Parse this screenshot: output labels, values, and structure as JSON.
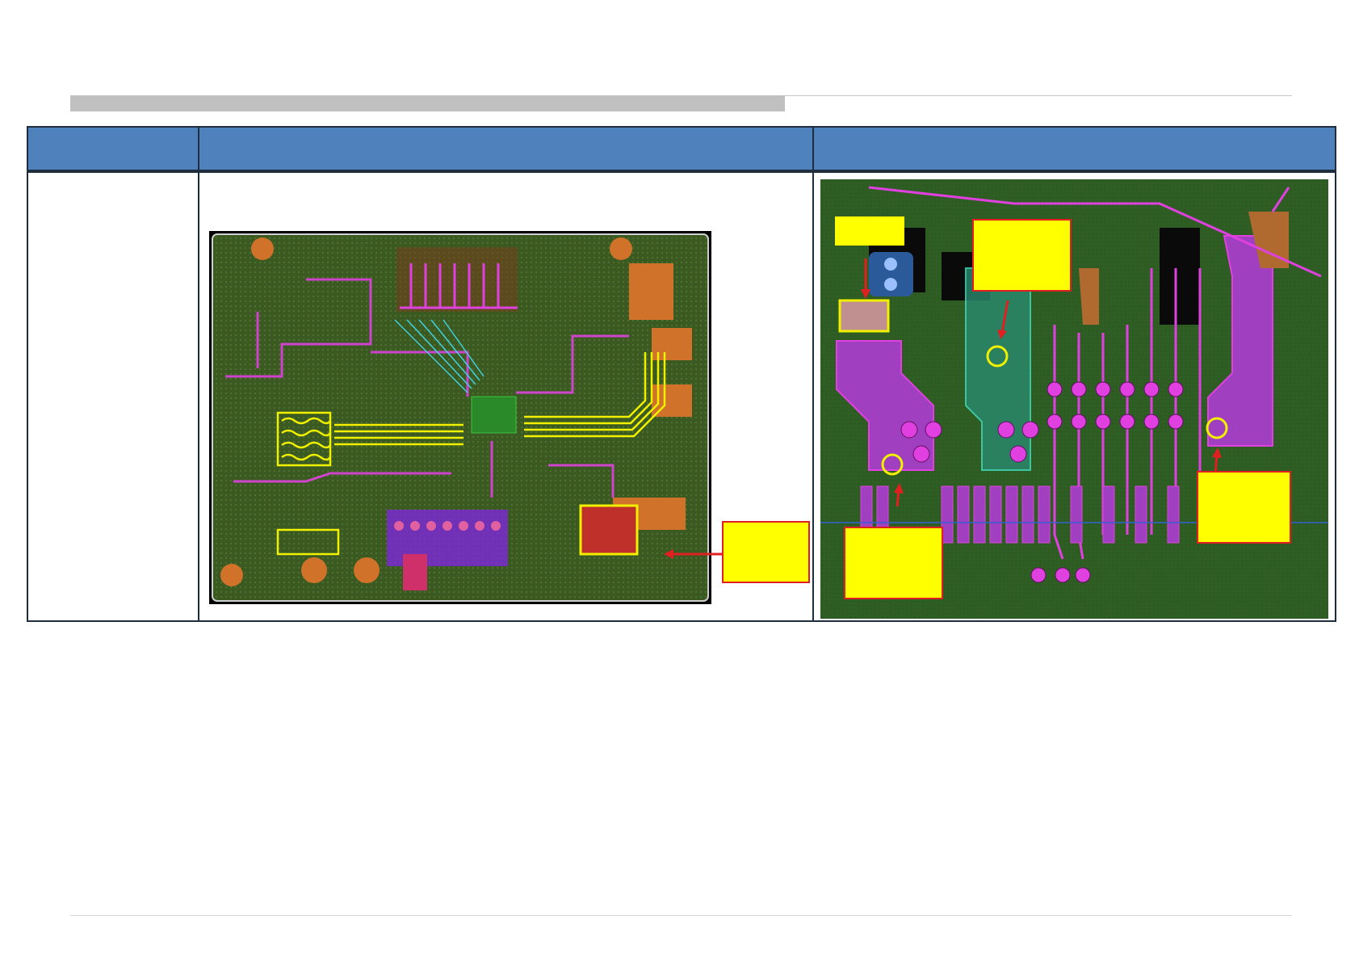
{
  "document": {
    "title": "",
    "table": {
      "headers": [
        "",
        "",
        ""
      ],
      "row": {
        "col1": "",
        "col2_text": "",
        "col3": ""
      }
    },
    "callouts": {
      "overview_note": "",
      "top_left_label": "",
      "top_middle_label": "",
      "right_label": "",
      "bottom_left_label": ""
    },
    "colors": {
      "header_blue": "#4f81bd",
      "pcb_green": "#3a6b2a",
      "trace_magenta": "#e040e0",
      "trace_yellow": "#f0f000",
      "callout_yellow": "#ffff00",
      "arrow_red": "#e02020"
    }
  }
}
